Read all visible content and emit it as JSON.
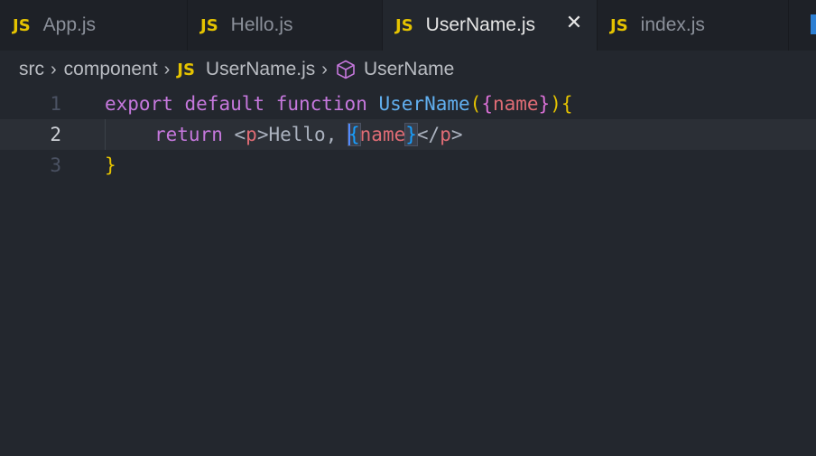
{
  "tabs": [
    {
      "badge": "JS",
      "label": "App.js",
      "active": false
    },
    {
      "badge": "JS",
      "label": "Hello.js",
      "active": false
    },
    {
      "badge": "JS",
      "label": "UserName.js",
      "active": true,
      "close": "✕"
    },
    {
      "badge": "JS",
      "label": "index.js",
      "active": false
    }
  ],
  "breadcrumb": {
    "items": [
      "src",
      "component",
      "UserName.js",
      "UserName"
    ],
    "separator": "›",
    "file_badge": "JS"
  },
  "editor": {
    "current_line": 2,
    "lines": [
      {
        "number": "1",
        "tokens": {
          "kw1": "export",
          "kw2": "default",
          "kw3": "function",
          "fn": "UserName",
          "open_paren": "(",
          "open_brace": "{",
          "param": "name",
          "close_brace": "}",
          "close_paren": ")",
          "body_open": "{"
        }
      },
      {
        "number": "2",
        "tokens": {
          "kw": "return",
          "lt1": "<",
          "tag1": "p",
          "gt1": ">",
          "text": "Hello, ",
          "open_brace": "{",
          "var": "name",
          "close_brace": "}",
          "lt2": "</",
          "tag2": "p",
          "gt2": ">"
        }
      },
      {
        "number": "3",
        "tokens": {
          "body_close": "}"
        }
      }
    ]
  },
  "colors": {
    "background": "#23272e",
    "tabbar": "#1e2127",
    "js_badge": "#e5c300",
    "keyword": "#c678dd",
    "function": "#61afef",
    "variable": "#e06c75",
    "caret": "#528bff"
  },
  "icons": {
    "breadcrumb_symbol": "cube-icon",
    "tab_close": "close-icon"
  }
}
